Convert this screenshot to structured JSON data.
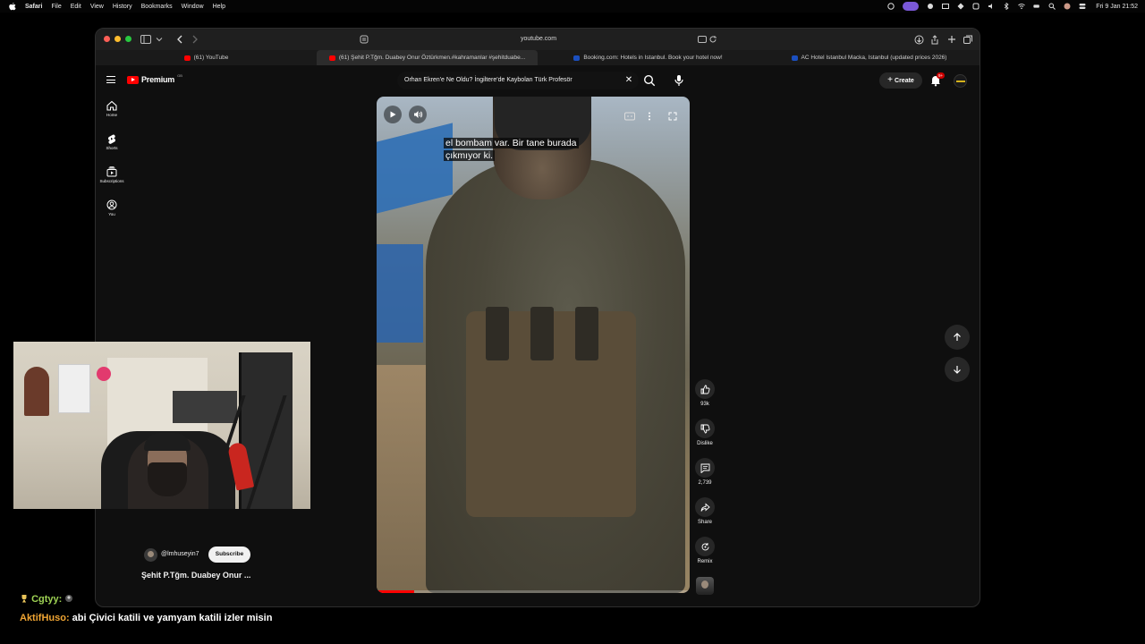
{
  "menubar": {
    "app": "Safari",
    "items": [
      "File",
      "Edit",
      "View",
      "History",
      "Bookmarks",
      "Window",
      "Help"
    ],
    "clock": "Fri 9 Jan  21:52"
  },
  "safari": {
    "address": "youtube.com",
    "tabs": [
      {
        "label": "(61) YouTube",
        "favicon": "youtube"
      },
      {
        "label": "(61) Şehit P.Tğm. Duabey Onur Öztürkmen.#kahramanlar #şehitduabe...",
        "favicon": "youtube",
        "active": true
      },
      {
        "label": "Booking.com: Hotels in Istanbul. Book your hotel now!",
        "favicon": "booking"
      },
      {
        "label": "AC Hotel Istanbul Macka, Istanbul (updated prices 2026)",
        "favicon": "booking"
      }
    ]
  },
  "youtube": {
    "logo_word": "Premium",
    "logo_sup": "GB",
    "search_value": "Orhan Ekren'e Ne Oldu? İngiltere'de Kaybolan Türk Profesör",
    "create_label": "Create",
    "notification_badge": "9+",
    "nav": [
      {
        "label": "Home",
        "icon": "home-icon"
      },
      {
        "label": "Shorts",
        "icon": "shorts-icon"
      },
      {
        "label": "Subscriptions",
        "icon": "subscriptions-icon"
      },
      {
        "label": "You",
        "icon": "you-icon"
      }
    ]
  },
  "video": {
    "subtitle_line1": "el bombam var. Bir tane burada",
    "subtitle_line2": "çıkmıyor ki.",
    "progress": 0.12
  },
  "actions": {
    "like_count": "93k",
    "dislike_label": "Dislike",
    "comments_count": "2,739",
    "share_label": "Share",
    "remix_label": "Remix"
  },
  "channel": {
    "handle": "@lmhuseyin7",
    "subscribe_label": "Subscribe",
    "short_title": "Şehit P.Tğm. Duabey Onur ..."
  },
  "chat": [
    {
      "user": "Cgtyy:",
      "message": ""
    },
    {
      "user": "AktifHuso:",
      "message": "abi Çivici katili ve yamyam katili izler misin"
    }
  ],
  "colors": {
    "yt_red": "#ff0000",
    "chip_bg": "#272727",
    "page_bg": "#0f0f0f",
    "chat_user1": "#9fd354",
    "chat_user2": "#f0a533"
  }
}
